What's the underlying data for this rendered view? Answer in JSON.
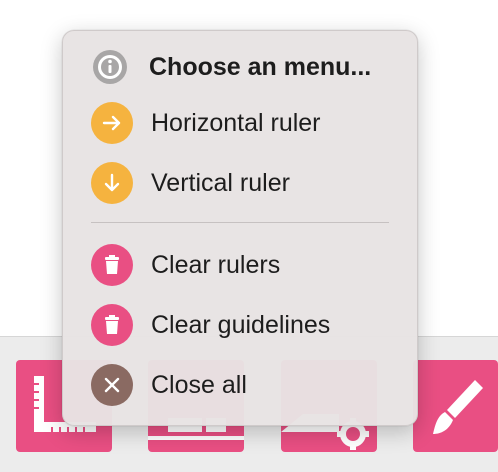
{
  "menu": {
    "header": {
      "label": "Choose an menu...",
      "icon": "info-icon"
    },
    "items": [
      {
        "label": "Horizontal ruler",
        "icon": "arrow-right-icon",
        "color": "#f5b33f"
      },
      {
        "label": "Vertical ruler",
        "icon": "arrow-down-icon",
        "color": "#f5b33f"
      },
      {
        "label": "Clear rulers",
        "icon": "trash-icon",
        "color": "#e94f83"
      },
      {
        "label": "Clear guidelines",
        "icon": "trash-icon",
        "color": "#e94f83"
      },
      {
        "label": "Close all",
        "icon": "close-icon",
        "color": "#8a6a62"
      }
    ]
  },
  "toolbar": {
    "accent": "#e94f83",
    "buttons": [
      {
        "icon": "ruler-icon"
      },
      {
        "icon": "layout-icon"
      },
      {
        "icon": "settings-icon"
      },
      {
        "icon": "brush-icon"
      }
    ]
  }
}
